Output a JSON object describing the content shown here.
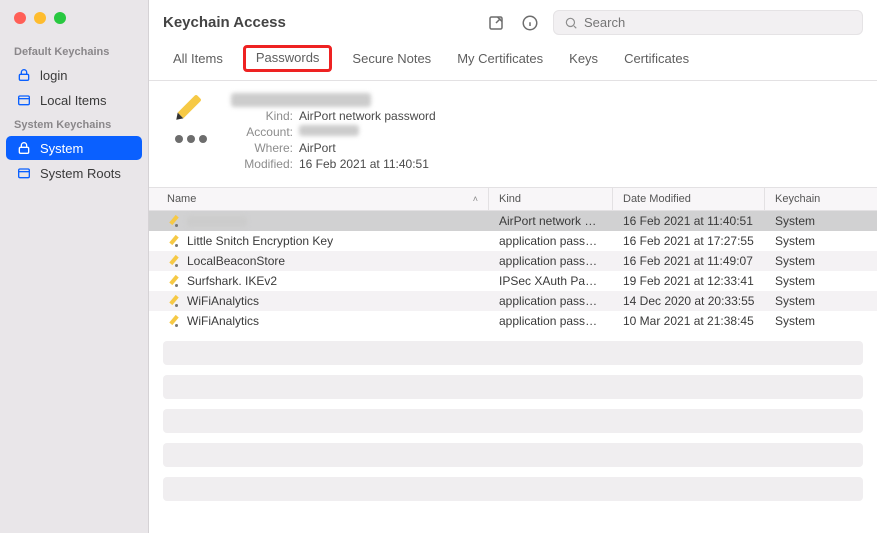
{
  "window": {
    "title": "Keychain Access"
  },
  "search": {
    "placeholder": "Search"
  },
  "sidebar": {
    "section_default": "Default Keychains",
    "section_system": "System Keychains",
    "items_default": [
      {
        "label": "login"
      },
      {
        "label": "Local Items"
      }
    ],
    "items_system": [
      {
        "label": "System",
        "selected": true
      },
      {
        "label": "System Roots"
      }
    ]
  },
  "tabs": [
    {
      "label": "All Items"
    },
    {
      "label": "Passwords",
      "highlighted": true
    },
    {
      "label": "Secure Notes"
    },
    {
      "label": "My Certificates"
    },
    {
      "label": "Keys"
    },
    {
      "label": "Certificates"
    }
  ],
  "detail": {
    "name_redacted": true,
    "kind_label": "Kind:",
    "kind": "AirPort network password",
    "account_label": "Account:",
    "account_redacted": true,
    "where_label": "Where:",
    "where": "AirPort",
    "modified_label": "Modified:",
    "modified": "16 Feb 2021 at 11:40:51"
  },
  "columns": {
    "name": "Name",
    "kind": "Kind",
    "date": "Date Modified",
    "keychain": "Keychain"
  },
  "rows": [
    {
      "name": "",
      "name_redacted": true,
      "kind": "AirPort network pass…",
      "date": "16 Feb 2021 at 11:40:51",
      "keychain": "System",
      "selected": true
    },
    {
      "name": "Little Snitch Encryption Key",
      "kind": "application password",
      "date": "16 Feb 2021 at 17:27:55",
      "keychain": "System"
    },
    {
      "name": "LocalBeaconStore",
      "kind": "application password",
      "date": "16 Feb 2021 at 11:49:07",
      "keychain": "System"
    },
    {
      "name": "Surfshark. IKEv2",
      "kind": "IPSec XAuth Passw…",
      "date": "19 Feb 2021 at 12:33:41",
      "keychain": "System"
    },
    {
      "name": "WiFiAnalytics",
      "kind": "application password",
      "date": "14 Dec 2020 at 20:33:55",
      "keychain": "System"
    },
    {
      "name": "WiFiAnalytics",
      "kind": "application password",
      "date": "10 Mar 2021 at 21:38:45",
      "keychain": "System"
    }
  ]
}
